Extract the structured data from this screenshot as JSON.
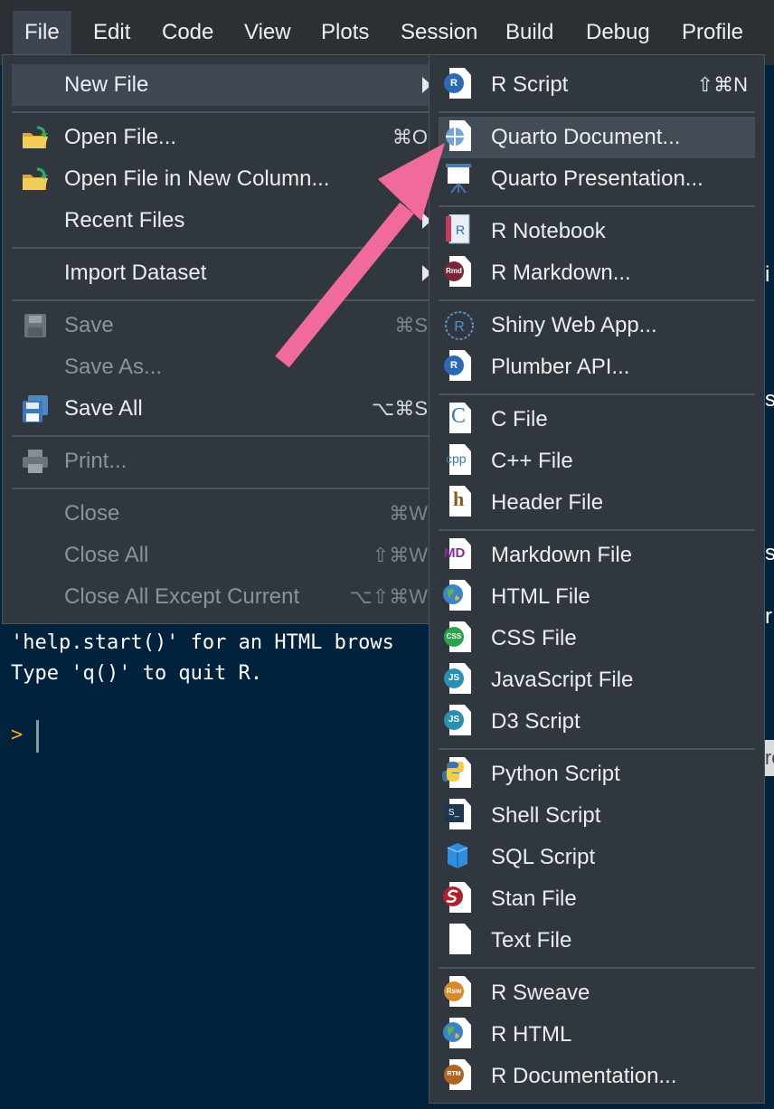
{
  "menubar": {
    "items": [
      {
        "label": "File",
        "active": true
      },
      {
        "label": "Edit"
      },
      {
        "label": "Code"
      },
      {
        "label": "View"
      },
      {
        "label": "Plots"
      },
      {
        "label": "Session"
      },
      {
        "label": "Build"
      },
      {
        "label": "Debug"
      },
      {
        "label": "Profile"
      }
    ]
  },
  "file_menu": {
    "new_file": {
      "label": "New File"
    },
    "open_file": {
      "label": "Open File...",
      "shortcut": "⌘O"
    },
    "open_file_new_column": {
      "label": "Open File in New Column..."
    },
    "recent_files": {
      "label": "Recent Files"
    },
    "import_dataset": {
      "label": "Import Dataset"
    },
    "save": {
      "label": "Save",
      "shortcut": "⌘S"
    },
    "save_as": {
      "label": "Save As..."
    },
    "save_all": {
      "label": "Save All",
      "shortcut": "⌥⌘S"
    },
    "print": {
      "label": "Print..."
    },
    "close": {
      "label": "Close",
      "shortcut": "⌘W"
    },
    "close_all": {
      "label": "Close All",
      "shortcut": "⇧⌘W"
    },
    "close_all_except_current": {
      "label": "Close All Except Current",
      "shortcut": "⌥⇧⌘W"
    }
  },
  "new_file_menu": {
    "r_script": {
      "label": "R Script",
      "shortcut": "⇧⌘N",
      "icon": "r-script-icon"
    },
    "quarto_document": {
      "label": "Quarto Document...",
      "icon": "quarto-icon"
    },
    "quarto_presentation": {
      "label": "Quarto Presentation...",
      "icon": "presentation-icon"
    },
    "r_notebook": {
      "label": "R Notebook",
      "icon": "notebook-icon",
      "icon_text": "R"
    },
    "r_markdown": {
      "label": "R Markdown...",
      "icon": "rmarkdown-icon",
      "icon_text": "Rmd"
    },
    "shiny_web_app": {
      "label": "Shiny Web App...",
      "icon": "shiny-icon",
      "icon_text": "R"
    },
    "plumber_api": {
      "label": "Plumber API...",
      "icon": "plumber-icon",
      "icon_text": "R"
    },
    "c_file": {
      "label": "C File",
      "icon": "c-file-icon",
      "icon_text": "C"
    },
    "cpp_file": {
      "label": "C++ File",
      "icon": "cpp-file-icon",
      "icon_text": "cpp"
    },
    "header_file": {
      "label": "Header File",
      "icon": "header-file-icon",
      "icon_text": "h"
    },
    "markdown_file": {
      "label": "Markdown File",
      "icon": "markdown-icon",
      "icon_text": "MD"
    },
    "html_file": {
      "label": "HTML File",
      "icon": "globe-icon"
    },
    "css_file": {
      "label": "CSS File",
      "icon": "css-icon",
      "icon_text": "CSS"
    },
    "javascript_file": {
      "label": "JavaScript File",
      "icon": "javascript-icon",
      "icon_text": "JS"
    },
    "d3_script": {
      "label": "D3 Script",
      "icon": "d3-icon",
      "icon_text": "JS"
    },
    "python_script": {
      "label": "Python Script",
      "icon": "python-icon"
    },
    "shell_script": {
      "label": "Shell Script",
      "icon": "shell-icon",
      "icon_text": "S_"
    },
    "sql_script": {
      "label": "SQL Script",
      "icon": "database-icon"
    },
    "stan_file": {
      "label": "Stan File",
      "icon": "stan-icon"
    },
    "text_file": {
      "label": "Text File",
      "icon": "text-file-icon"
    },
    "r_sweave": {
      "label": "R Sweave",
      "icon": "sweave-icon",
      "icon_text": "Rsw"
    },
    "r_html": {
      "label": "R HTML",
      "icon": "globe-icon"
    },
    "r_documentation": {
      "label": "R Documentation...",
      "icon": "rd-icon",
      "icon_text": "RTM"
    }
  },
  "console": {
    "line1": "'help.start()' for an HTML brows",
    "line2": "Type 'q()' to quit R.",
    "prompt": ">"
  },
  "background_edge_chars": [
    "i",
    "s",
    "s",
    "r"
  ],
  "tooltip": {
    "text": "Cre"
  },
  "colors": {
    "menubar_bg": "#2b3035",
    "menu_bg": "#30373f",
    "highlight": "#434b55",
    "console_bg": "#00223d",
    "prompt": "#f5a623",
    "annotation_arrow": "#f06a9b"
  }
}
